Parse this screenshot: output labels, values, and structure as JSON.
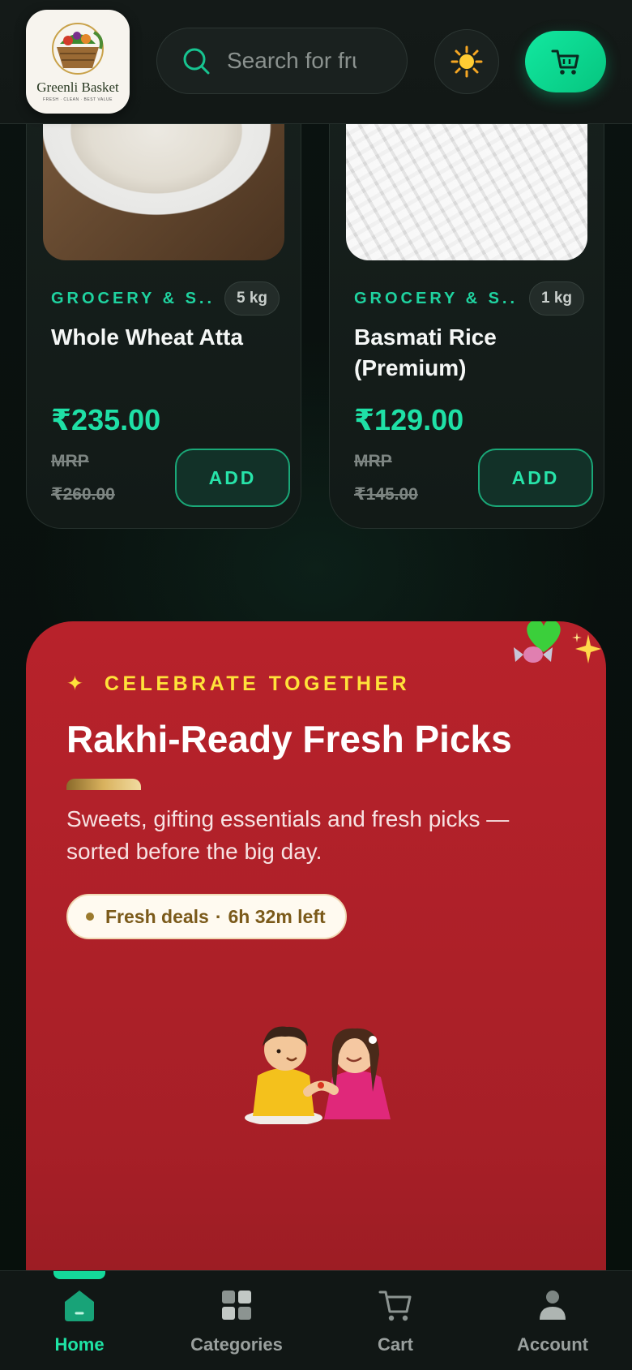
{
  "header": {
    "logo_text": "Greenli Basket",
    "logo_sub": "FRESH · CLEAN · BEST VALUE",
    "search_placeholder": "Search for fruits, vegetables..."
  },
  "products": [
    {
      "category": "GROCERY & S...",
      "quantity": "5 kg",
      "name": "Whole Wheat Atta",
      "price": "₹235.00",
      "mrp_label": "MRP",
      "mrp_value": "₹260.00",
      "add_label": "ADD"
    },
    {
      "category": "GROCERY & S...",
      "quantity": "1 kg",
      "name": "Basmati Rice (Premium)",
      "price": "₹129.00",
      "mrp_label": "MRP",
      "mrp_value": "₹145.00",
      "add_label": "ADD"
    }
  ],
  "promo": {
    "kicker_icon": "✦",
    "kicker": "CELEBRATE TOGETHER",
    "title": "Rakhi-Ready Fresh Picks",
    "description": "Sweets, gifting essentials and fresh picks — sorted before the big day.",
    "deal_label": "Fresh deals",
    "deal_sep": "·",
    "deal_time": "6h 32m left"
  },
  "nav": {
    "items": [
      {
        "label": "Home",
        "icon": "home-icon",
        "active": true
      },
      {
        "label": "Categories",
        "icon": "grid-icon",
        "active": false
      },
      {
        "label": "Cart",
        "icon": "cart-icon",
        "active": false
      },
      {
        "label": "Account",
        "icon": "user-icon",
        "active": false
      }
    ]
  },
  "colors": {
    "accent": "#1fe0a6",
    "promo_bg": "#b8222b",
    "kicker": "#ffe23a"
  }
}
